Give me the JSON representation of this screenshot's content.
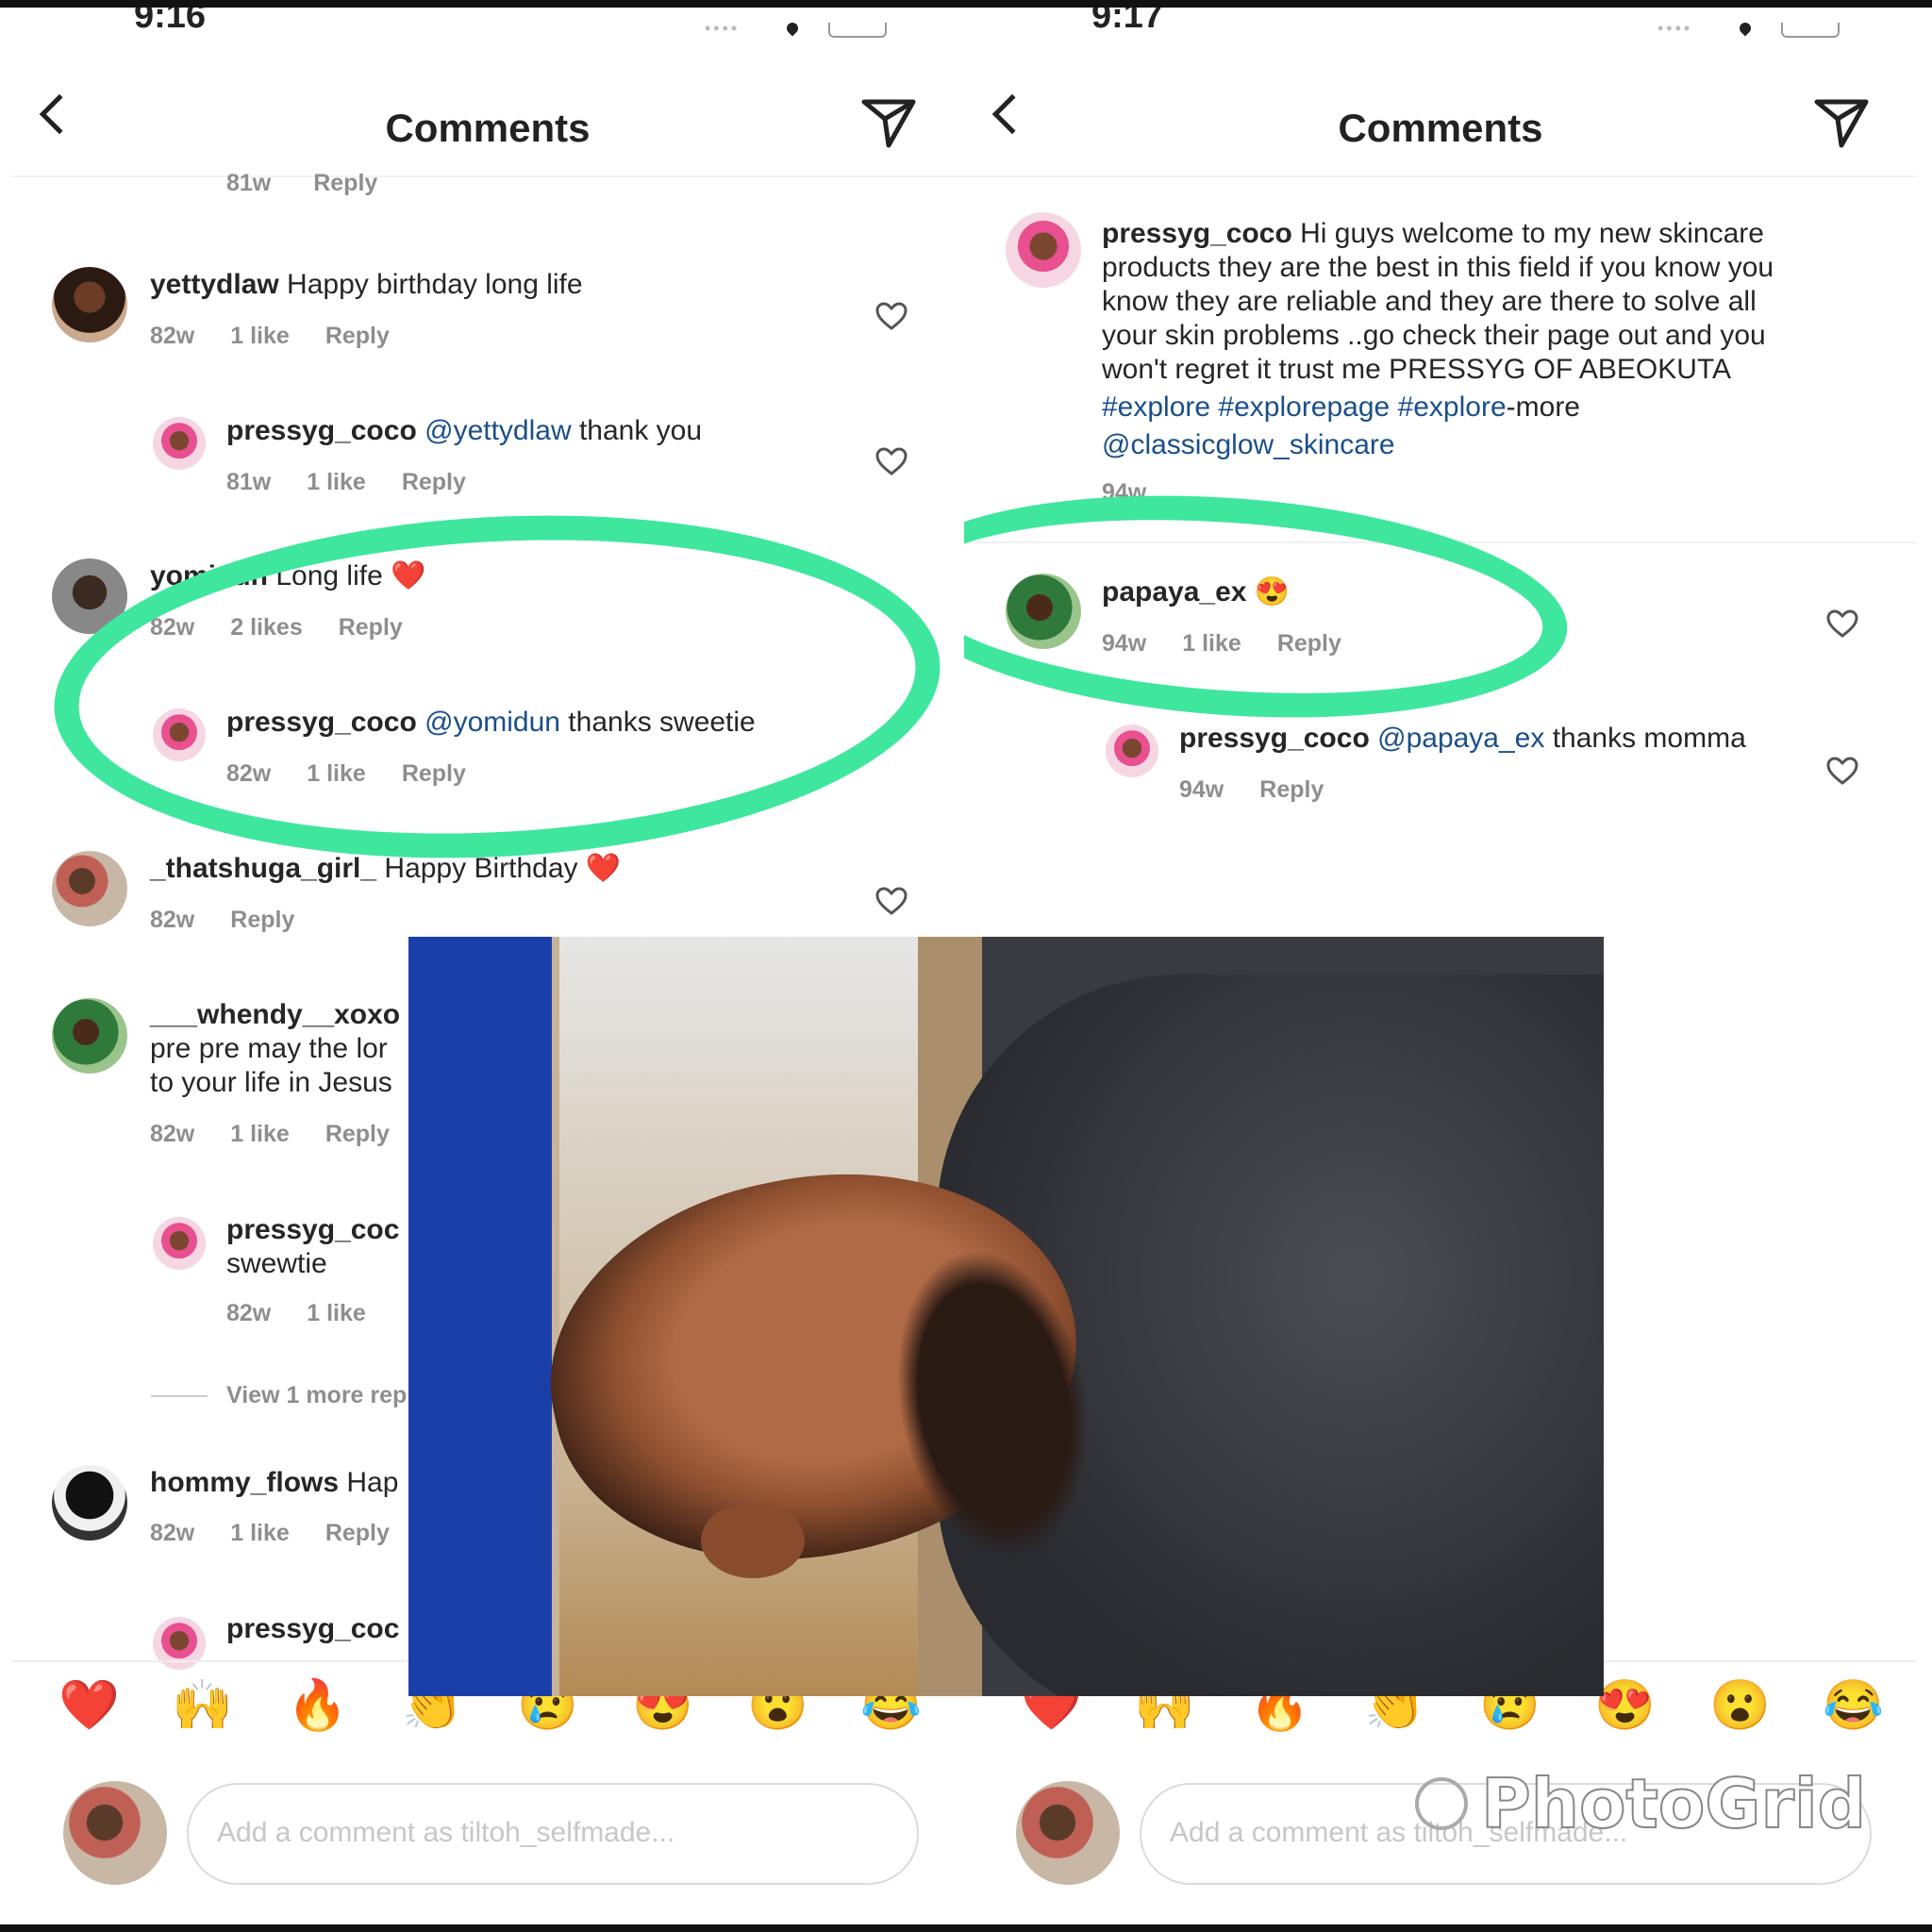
{
  "header": {
    "title": "Comments"
  },
  "left": {
    "status_time": "9:16",
    "prev_meta": {
      "time": "81w",
      "reply": "Reply"
    },
    "comments": [
      {
        "user": "yettydlaw",
        "text": " Happy birthday long life",
        "time": "82w",
        "likes": "1 like",
        "reply": "Reply"
      },
      {
        "user": "pressyg_coco",
        "mention": " @yettydlaw",
        "text": " thank you",
        "time": "81w",
        "likes": "1 like",
        "reply": "Reply"
      },
      {
        "user": "yomidun",
        "text": " Long life ❤️",
        "time": "82w",
        "likes": "2 likes",
        "reply": "Reply"
      },
      {
        "user": "pressyg_coco",
        "mention": " @yomidun",
        "text": " thanks sweetie",
        "time": "82w",
        "likes": "1 like",
        "reply": "Reply"
      },
      {
        "user": "_thatshuga_girl_",
        "text": " Happy Birthday ❤️",
        "time": "82w",
        "reply": "Reply"
      },
      {
        "user": "___whendy__xoxo",
        "line2": "pre pre may the lor",
        "line3": "to your life in Jesus",
        "time": "82w",
        "likes": "1 like",
        "reply": "Reply"
      },
      {
        "user": "pressyg_coc",
        "line2": "swewtie",
        "time": "82w",
        "likes": "1 like"
      },
      {
        "user": "hommy_flows",
        "text": " Hap",
        "time": "82w",
        "likes": "1 like",
        "reply": "Reply"
      },
      {
        "user": "pressyg_coc"
      }
    ],
    "view_more": "View 1 more rep",
    "composer_placeholder": "Add a comment as tiltoh_selfmade..."
  },
  "right": {
    "status_time": "9:17",
    "caption": {
      "user": "pressyg_coco",
      "line1": " Hi guys welcome to my new skincare",
      "line2": "products they are the best in this field if you know you",
      "line3": "know they are reliable and they are there to solve all",
      "line4": "your skin problems ..go check their page out and you",
      "line5": "won't regret it trust me PRESSYG OF ABEOKUTA",
      "tags": "#explore #explorepage #explore",
      "tags_suffix": "-more",
      "mention": "@classicglow_skincare",
      "time": "94w"
    },
    "comments": [
      {
        "user": "papaya_ex",
        "text": " 😍",
        "time": "94w",
        "likes": "1 like",
        "reply": "Reply"
      },
      {
        "user": "pressyg_coco",
        "mention": " @papaya_ex",
        "text": " thanks momma",
        "time": "94w",
        "reply": "Reply"
      }
    ],
    "composer_placeholder": "Add a comment as tiltoh_selfmade..."
  },
  "emojis": [
    "❤️",
    "🙌",
    "🔥",
    "👏",
    "😢",
    "😍",
    "😮",
    "😂"
  ],
  "watermark": "PhotoGrid",
  "colors": {
    "highlight": "#3ee79d",
    "mention": "#1b4f8a",
    "meta": "#8e8e8e"
  }
}
